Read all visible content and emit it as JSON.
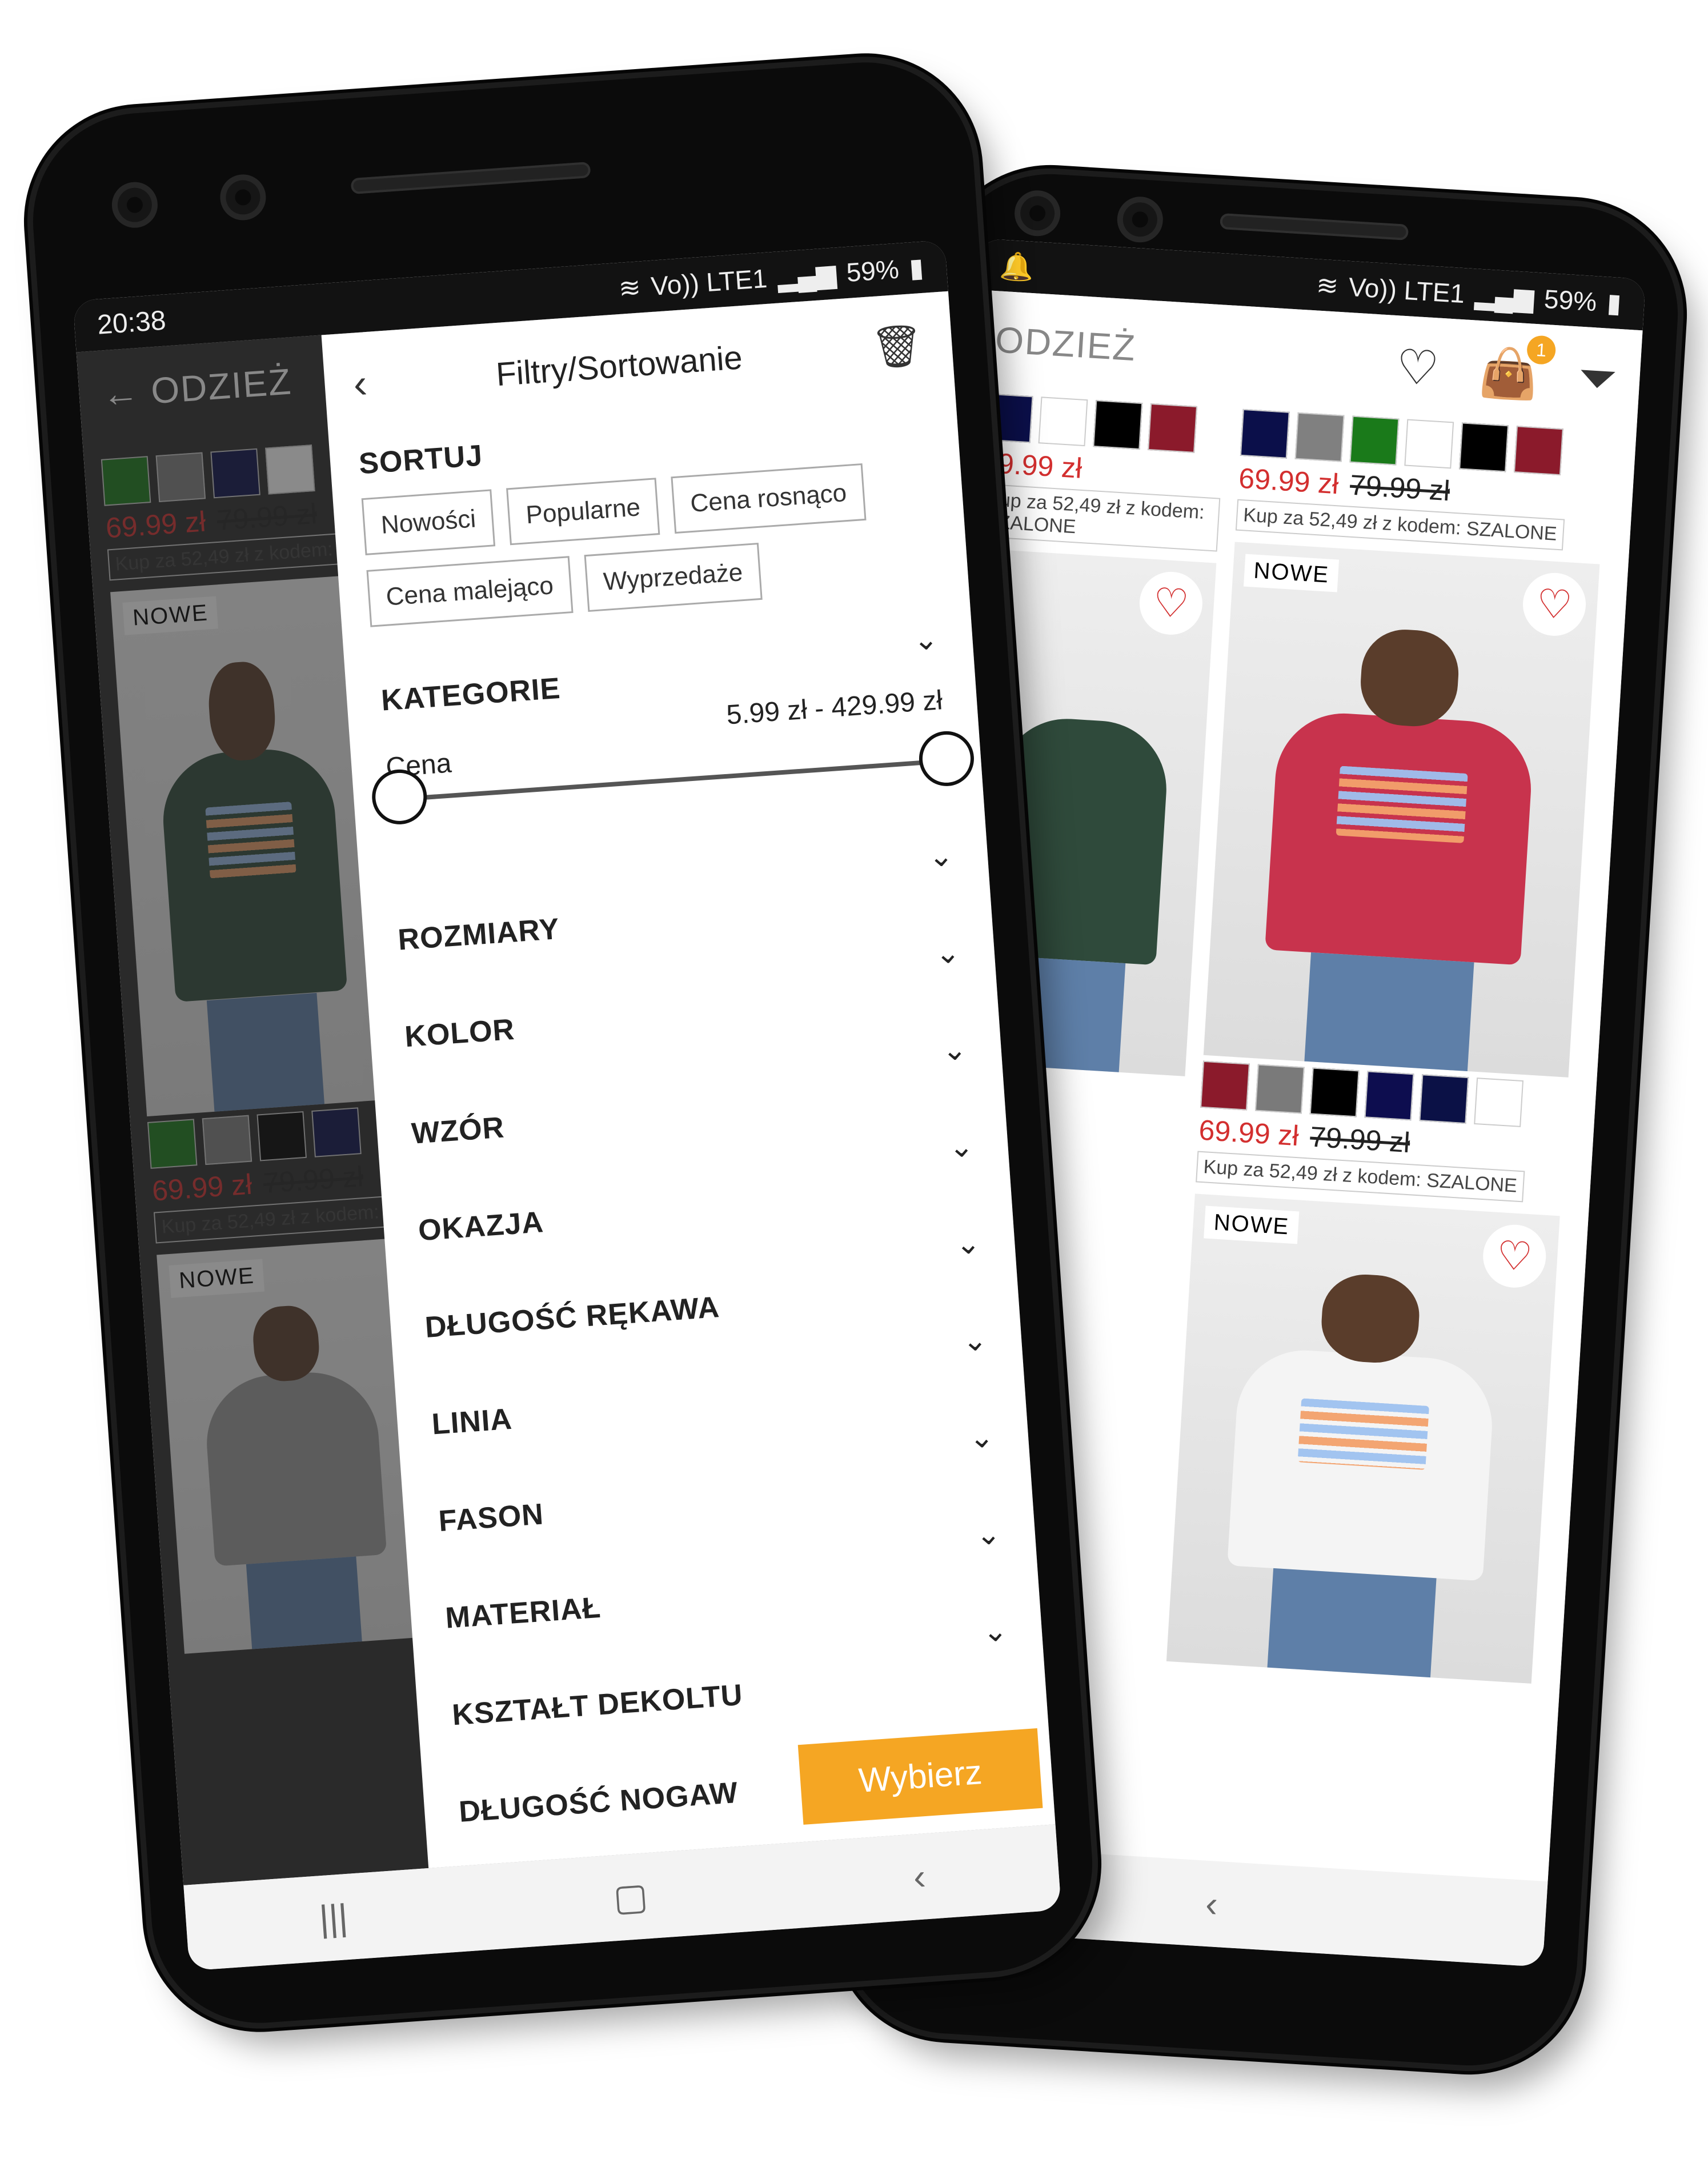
{
  "status": {
    "time": "20:38",
    "battery": "59%",
    "network": "Vo)) LTE1"
  },
  "catalog": {
    "title": "ODZIEŻ",
    "cart_count": "1",
    "products": [
      {
        "badge": "",
        "price": "69.99 zł",
        "old_price": "79.99 zł",
        "promo": "Kup za 52,49 zł z kodem: SZALONE"
      },
      {
        "badge": "NOWE",
        "price": "69.99 zł",
        "old_price": "79.99 zł",
        "promo": "Kup za 52,49 zł z kodem: SZALONE"
      },
      {
        "badge": "NOWE",
        "price": "",
        "old_price": "",
        "promo": ""
      }
    ],
    "swatch_colors": [
      "#8b1a2b",
      "#7a7a7a",
      "#000000",
      "#0d0d4f",
      "#0b1146",
      "#ffffff"
    ],
    "swatch_colors_b": [
      "#0b0f4a",
      "#808080",
      "#1a7a1a",
      "#ffffff",
      "#000000",
      "#8b1a2b"
    ],
    "shirt_colors": [
      "#c8334d",
      "#f4f4f4"
    ]
  },
  "left_catalog": {
    "title": "ODZIEŻ",
    "price": "69.99 zł",
    "old_price": "79.99 zł",
    "promo": "Kup za 52,49 zł z kodem:",
    "badge": "NOWE"
  },
  "filters": {
    "title": "Filtry/Sortowanie",
    "sort_title": "SORTUJ",
    "sort_options": [
      "Nowości",
      "Popularne",
      "Cena rosnąco",
      "Cena malejąco",
      "Wyprzedaże"
    ],
    "price_label": "Cena",
    "price_range": "5.99 zł - 429.99 zł",
    "price_min_fraction": 0,
    "price_max_fraction": 1,
    "sections": [
      "KATEGORIE",
      "ROZMIARY",
      "KOLOR",
      "WZÓR",
      "OKAZJA",
      "DŁUGOŚĆ RĘKAWA",
      "LINIA",
      "FASON",
      "MATERIAŁ",
      "KSZTAŁT DEKOLTU",
      "DŁUGOŚĆ NOGAW"
    ],
    "apply_label": "Wybierz"
  },
  "colors": {
    "accent": "#f5a623",
    "sale": "#d32f2f"
  }
}
